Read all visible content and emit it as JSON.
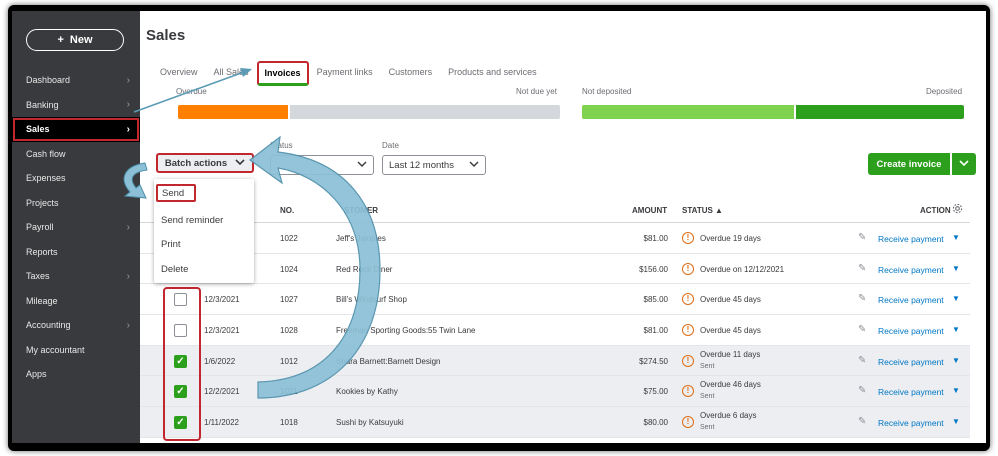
{
  "sidebar": {
    "new_label": "New",
    "items": [
      {
        "label": "Dashboard",
        "chev": true
      },
      {
        "label": "Banking",
        "chev": true
      },
      {
        "label": "Sales",
        "chev": true,
        "active": true
      },
      {
        "label": "Cash flow",
        "chev": false
      },
      {
        "label": "Expenses",
        "chev": true
      },
      {
        "label": "Projects",
        "chev": false
      },
      {
        "label": "Payroll",
        "chev": true
      },
      {
        "label": "Reports",
        "chev": false
      },
      {
        "label": "Taxes",
        "chev": true
      },
      {
        "label": "Mileage",
        "chev": false
      },
      {
        "label": "Accounting",
        "chev": true
      },
      {
        "label": "My accountant",
        "chev": false
      },
      {
        "label": "Apps",
        "chev": false
      }
    ]
  },
  "header": {
    "title": "Sales",
    "tabs": [
      "Overview",
      "All Sales",
      "Invoices",
      "Payment links",
      "Customers",
      "Products and services"
    ],
    "active_tab": "Invoices"
  },
  "money_bar": {
    "overdue_label": "Overdue",
    "not_due_label": "Not due yet",
    "not_deposited_label": "Not deposited",
    "deposited_label": "Deposited"
  },
  "filters": {
    "batch_label": "Batch actions",
    "status_label": "Status",
    "status_value": "",
    "date_label": "Date",
    "date_value": "Last 12 months",
    "create_label": "Create invoice"
  },
  "batch_menu": [
    "Send",
    "Send reminder",
    "Print",
    "Delete"
  ],
  "table": {
    "headers": {
      "no": "NO.",
      "customer": "STOMER",
      "amount": "AMOUNT",
      "status": "STATUS ▲",
      "action": "ACTION"
    },
    "action_label": "Receive payment",
    "rows": [
      {
        "date": "",
        "no": "1022",
        "customer": "Jeff's Jalopies",
        "amount": "$81.00",
        "status": "Overdue 19 days",
        "sub": "",
        "checked": null
      },
      {
        "date": "",
        "no": "1024",
        "customer": "Red Rock Diner",
        "amount": "$156.00",
        "status": "Overdue on 12/12/2021",
        "sub": "",
        "checked": null
      },
      {
        "date": "12/3/2021",
        "no": "1027",
        "customer": "Bill's Windsurf Shop",
        "amount": "$85.00",
        "status": "Overdue 45 days",
        "sub": "",
        "checked": false
      },
      {
        "date": "12/3/2021",
        "no": "1028",
        "customer": "Freeman Sporting Goods:55 Twin Lane",
        "amount": "$81.00",
        "status": "Overdue 45 days",
        "sub": "",
        "checked": false
      },
      {
        "date": "1/6/2022",
        "no": "1012",
        "customer": "Shara Barnett:Barnett Design",
        "amount": "$274.50",
        "status": "Overdue 11 days",
        "sub": "Sent",
        "checked": true
      },
      {
        "date": "12/2/2021",
        "no": "1021",
        "customer": "Kookies by Kathy",
        "amount": "$75.00",
        "status": "Overdue 46 days",
        "sub": "Sent",
        "checked": true
      },
      {
        "date": "1/11/2022",
        "no": "1018",
        "customer": "Sushi by Katsuyuki",
        "amount": "$80.00",
        "status": "Overdue 6 days",
        "sub": "Sent",
        "checked": true
      }
    ]
  },
  "colors": {
    "overdue": "#ff8000",
    "not_due": "#d4d7dc",
    "not_deposited": "#7fd34e",
    "deposited": "#2ca01c",
    "highlight": "#c1272d",
    "arrow": "#7fb8cf"
  }
}
